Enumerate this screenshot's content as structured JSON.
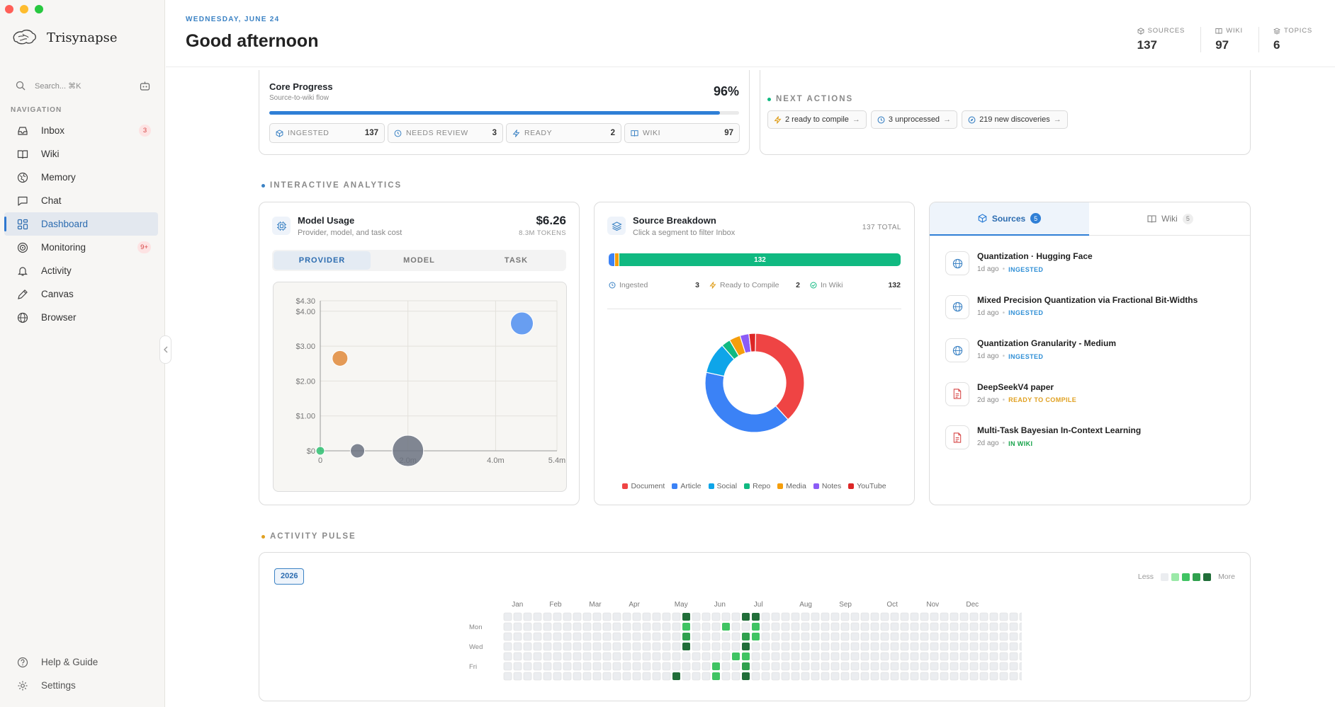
{
  "app": {
    "name": "Trisynapse"
  },
  "search": {
    "placeholder": "Search... ⌘K"
  },
  "nav": {
    "label": "NAVIGATION",
    "items": [
      {
        "label": "Inbox",
        "icon": "inbox-icon",
        "badge": "3"
      },
      {
        "label": "Wiki",
        "icon": "book-icon",
        "badge": ""
      },
      {
        "label": "Memory",
        "icon": "globe-icon",
        "badge": ""
      },
      {
        "label": "Chat",
        "icon": "chat-icon",
        "badge": ""
      },
      {
        "label": "Dashboard",
        "icon": "dashboard-icon",
        "badge": "",
        "active": true
      },
      {
        "label": "Monitoring",
        "icon": "monitoring-icon",
        "badge": "9+"
      },
      {
        "label": "Activity",
        "icon": "bell-icon",
        "badge": ""
      },
      {
        "label": "Canvas",
        "icon": "pencil-icon",
        "badge": ""
      },
      {
        "label": "Browser",
        "icon": "browser-globe-icon",
        "badge": ""
      }
    ],
    "bottom": [
      {
        "label": "Help & Guide",
        "icon": "help-icon"
      },
      {
        "label": "Settings",
        "icon": "gear-icon"
      }
    ]
  },
  "header": {
    "date": "WEDNESDAY, JUNE 24",
    "greeting": "Good afternoon",
    "stats": [
      {
        "label": "SOURCES",
        "value": "137",
        "icon": "cube-icon"
      },
      {
        "label": "WIKI",
        "value": "97",
        "icon": "book-icon"
      },
      {
        "label": "TOPICS",
        "value": "6",
        "icon": "layers-icon"
      }
    ]
  },
  "core": {
    "title": "Core Progress",
    "subtitle": "Source-to-wiki flow",
    "percent": "96%",
    "progress": 0.96,
    "stats": [
      {
        "label": "INGESTED",
        "value": "137",
        "icon": "cube-icon"
      },
      {
        "label": "NEEDS REVIEW",
        "value": "3",
        "icon": "clock-icon"
      },
      {
        "label": "READY",
        "value": "2",
        "icon": "bolt-icon"
      },
      {
        "label": "WIKI",
        "value": "97",
        "icon": "book-icon"
      }
    ]
  },
  "next": {
    "title": "NEXT ACTIONS",
    "chips": [
      {
        "label": "2 ready to compile",
        "icon": "bolt-icon"
      },
      {
        "label": "3 unprocessed",
        "icon": "clock-icon"
      },
      {
        "label": "219 new discoveries",
        "icon": "compass-icon"
      }
    ]
  },
  "analytics": {
    "label": "INTERACTIVE ANALYTICS"
  },
  "usage": {
    "title": "Model Usage",
    "subtitle": "Provider, model, and task cost",
    "cost": "$6.26",
    "tokens": "8.3M TOKENS",
    "tabs": [
      "PROVIDER",
      "MODEL",
      "TASK"
    ]
  },
  "breakdown": {
    "title": "Source Breakdown",
    "subtitle": "Click a segment to filter Inbox",
    "total": "137 TOTAL",
    "bar_label": "132",
    "stats": [
      {
        "label": "Ingested",
        "value": "3",
        "icon": "clock-icon"
      },
      {
        "label": "Ready to Compile",
        "value": "2",
        "icon": "bolt-icon"
      },
      {
        "label": "In Wiki",
        "value": "132",
        "icon": "check-icon"
      }
    ],
    "legend": [
      {
        "name": "Document",
        "color": "#ef4444"
      },
      {
        "name": "Article",
        "color": "#3b82f6"
      },
      {
        "name": "Social",
        "color": "#0ea5e9"
      },
      {
        "name": "Repo",
        "color": "#10b981"
      },
      {
        "name": "Media",
        "color": "#f59e0b"
      },
      {
        "name": "Notes",
        "color": "#8b5cf6"
      },
      {
        "name": "YouTube",
        "color": "#dc2626"
      }
    ]
  },
  "sources_panel": {
    "tabs": [
      {
        "label": "Sources",
        "count": "5"
      },
      {
        "label": "Wiki",
        "count": "5"
      }
    ],
    "items": [
      {
        "title": "Quantization · Hugging Face",
        "time": "1d ago",
        "status": "INGESTED",
        "status_color": "#2f8fd6",
        "icon": "globe-icon"
      },
      {
        "title": "Mixed Precision Quantization via Fractional Bit-Widths",
        "time": "1d ago",
        "status": "INGESTED",
        "status_color": "#2f8fd6",
        "icon": "globe-icon"
      },
      {
        "title": "Quantization Granularity - Medium",
        "time": "1d ago",
        "status": "INGESTED",
        "status_color": "#2f8fd6",
        "icon": "globe-icon"
      },
      {
        "title": "DeepSeekV4 paper",
        "time": "2d ago",
        "status": "READY TO COMPILE",
        "status_color": "#e0a020",
        "icon": "document-icon"
      },
      {
        "title": "Multi-Task Bayesian In-Context Learning",
        "time": "2d ago",
        "status": "IN WIKI",
        "status_color": "#16a34a",
        "icon": "document-icon"
      }
    ]
  },
  "pulse": {
    "label": "ACTIVITY PULSE",
    "year": "2026",
    "less": "Less",
    "more": "More",
    "months": [
      "Jan",
      "Feb",
      "Mar",
      "Apr",
      "May",
      "Jun",
      "Jul",
      "Aug",
      "Sep",
      "Oct",
      "Nov",
      "Dec"
    ],
    "days": [
      "Mon",
      "Wed",
      "Fri"
    ],
    "scale": [
      "#ebedf0",
      "#9be9a8",
      "#40c463",
      "#30a14e",
      "#216e39"
    ],
    "active_cells": [
      [
        17,
        6,
        4
      ],
      [
        18,
        0,
        4
      ],
      [
        18,
        1,
        2
      ],
      [
        18,
        2,
        3
      ],
      [
        18,
        3,
        4
      ],
      [
        21,
        6,
        2
      ],
      [
        21,
        5,
        2
      ],
      [
        22,
        1,
        2
      ],
      [
        23,
        4,
        2
      ],
      [
        24,
        0,
        4
      ],
      [
        24,
        2,
        3
      ],
      [
        24,
        3,
        4
      ],
      [
        24,
        4,
        2
      ],
      [
        24,
        5,
        3
      ],
      [
        24,
        6,
        4
      ],
      [
        25,
        0,
        4
      ],
      [
        25,
        1,
        2
      ],
      [
        25,
        2,
        2
      ]
    ]
  },
  "chart_data": [
    {
      "type": "scatter",
      "title": "Model Usage",
      "subtitle": "Provider, model, and task cost",
      "xlim": [
        0,
        5.4
      ],
      "ylim": [
        0,
        4.3
      ],
      "xticks": [
        "0",
        "2.0m",
        "4.0m",
        "5.4m"
      ],
      "yticks": [
        "$0",
        "$1.00",
        "$2.00",
        "$3.00",
        "$4.00",
        "$4.30"
      ],
      "points": [
        {
          "x": 0,
          "y": 0,
          "size": 6,
          "color": "#2fbf71"
        },
        {
          "x": 0.45,
          "y": 2.65,
          "size": 11,
          "color": "#e0893a"
        },
        {
          "x": 0.85,
          "y": 0,
          "size": 10,
          "color": "#6b7280"
        },
        {
          "x": 2.0,
          "y": 0,
          "size": 22,
          "color": "#6b7280"
        },
        {
          "x": 4.6,
          "y": 3.65,
          "size": 16,
          "color": "#4f8ef0"
        }
      ]
    },
    {
      "type": "pie",
      "title": "Source Breakdown",
      "total": 137,
      "slices": [
        {
          "name": "Document",
          "value": 52,
          "color": "#ef4444"
        },
        {
          "name": "Article",
          "value": 55,
          "color": "#3b82f6"
        },
        {
          "name": "Social",
          "value": 14,
          "color": "#0ea5e9"
        },
        {
          "name": "Repo",
          "value": 4,
          "color": "#10b981"
        },
        {
          "name": "Media",
          "value": 5,
          "color": "#f59e0b"
        },
        {
          "name": "Notes",
          "value": 4,
          "color": "#8b5cf6"
        },
        {
          "name": "YouTube",
          "value": 3,
          "color": "#dc2626"
        }
      ]
    },
    {
      "type": "bar",
      "title": "Source status",
      "series": [
        {
          "name": "Ingested",
          "value": 3,
          "color": "#3b82f6"
        },
        {
          "name": "Ready to Compile",
          "value": 2,
          "color": "#f59e0b"
        },
        {
          "name": "In Wiki",
          "value": 132,
          "color": "#10b981"
        }
      ]
    }
  ]
}
